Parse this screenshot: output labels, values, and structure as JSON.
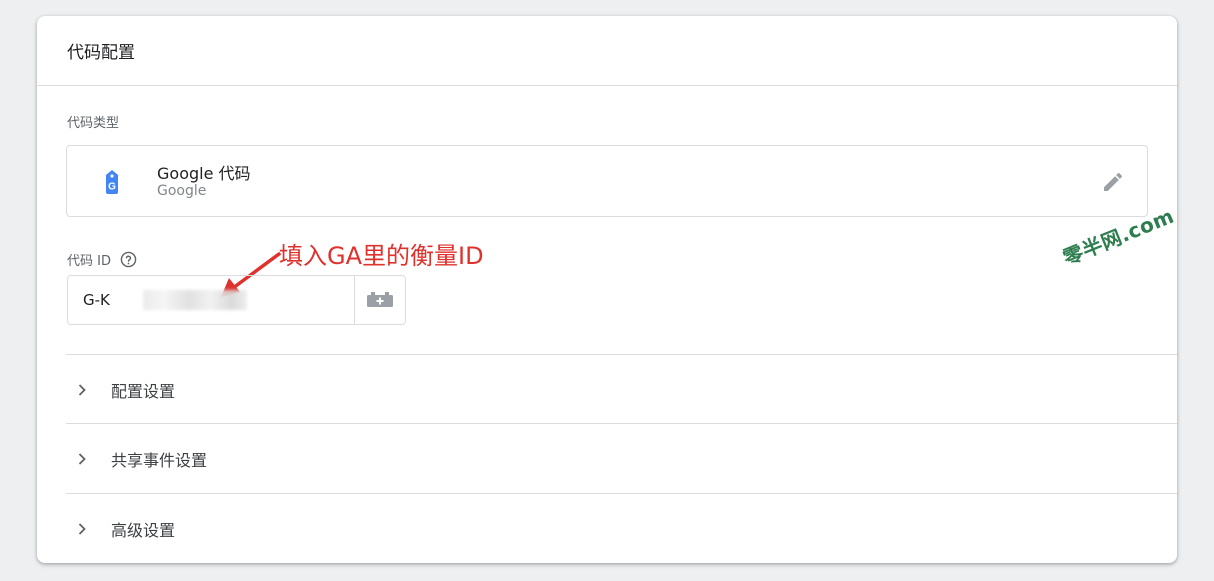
{
  "header": {
    "title": "代码配置"
  },
  "tag_type": {
    "section_label": "代码类型",
    "name": "Google 代码",
    "vendor": "Google",
    "icon": "google-tag-icon",
    "icon_letter": "G"
  },
  "tag_id": {
    "label": "代码 ID",
    "value": "G-K",
    "annotation": "填入GA里的衡量ID"
  },
  "sections": [
    {
      "label": "配置设置"
    },
    {
      "label": "共享事件设置"
    },
    {
      "label": "高级设置"
    }
  ],
  "watermark": "零半网.com",
  "colors": {
    "accent_blue": "#4285f4",
    "annotation_red": "#e0312c",
    "watermark_green": "#2e7d4f"
  }
}
